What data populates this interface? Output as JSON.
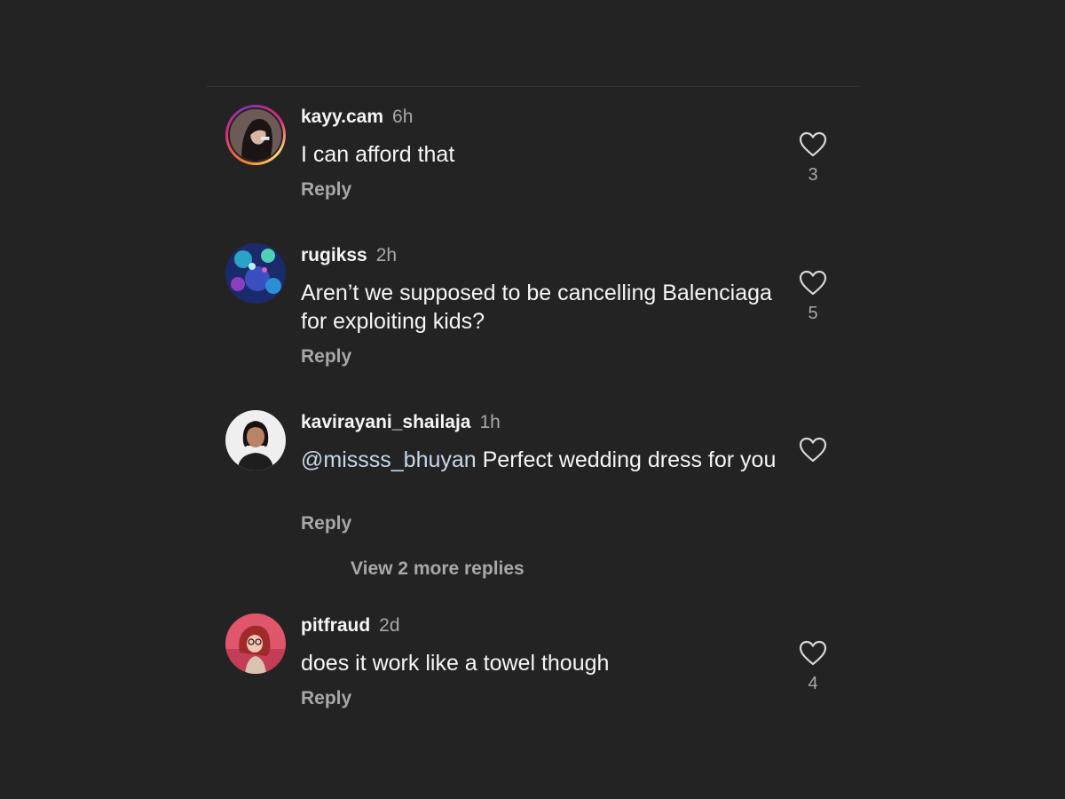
{
  "comments": [
    {
      "username": "kayy.cam",
      "time": "6h",
      "text": "I can afford that",
      "mention": "",
      "reply_label": "Reply",
      "likes": "3"
    },
    {
      "username": "rugikss",
      "time": "2h",
      "text": "Aren’t we supposed to be cancelling Balenciaga for exploiting kids?",
      "mention": "",
      "reply_label": "Reply",
      "likes": "5"
    },
    {
      "username": "kavirayani_shailaja",
      "time": "1h",
      "mention": "@missss_bhuyan",
      "text": " Perfect wedding dress for you",
      "reply_label": "Reply",
      "likes": ""
    },
    {
      "username": "pitfraud",
      "time": "2d",
      "text": "does it work like a towel though",
      "mention": "",
      "reply_label": "Reply",
      "likes": "4"
    }
  ],
  "view_more_replies": "View 2 more replies",
  "colors": {
    "background": "#232323",
    "primary_text": "#f5f5f5",
    "secondary_text": "#a8a8a8",
    "mention": "#c7d7ea",
    "story_ring": "#dd2a7b"
  },
  "icons": {
    "like": "heart-outline-icon"
  }
}
